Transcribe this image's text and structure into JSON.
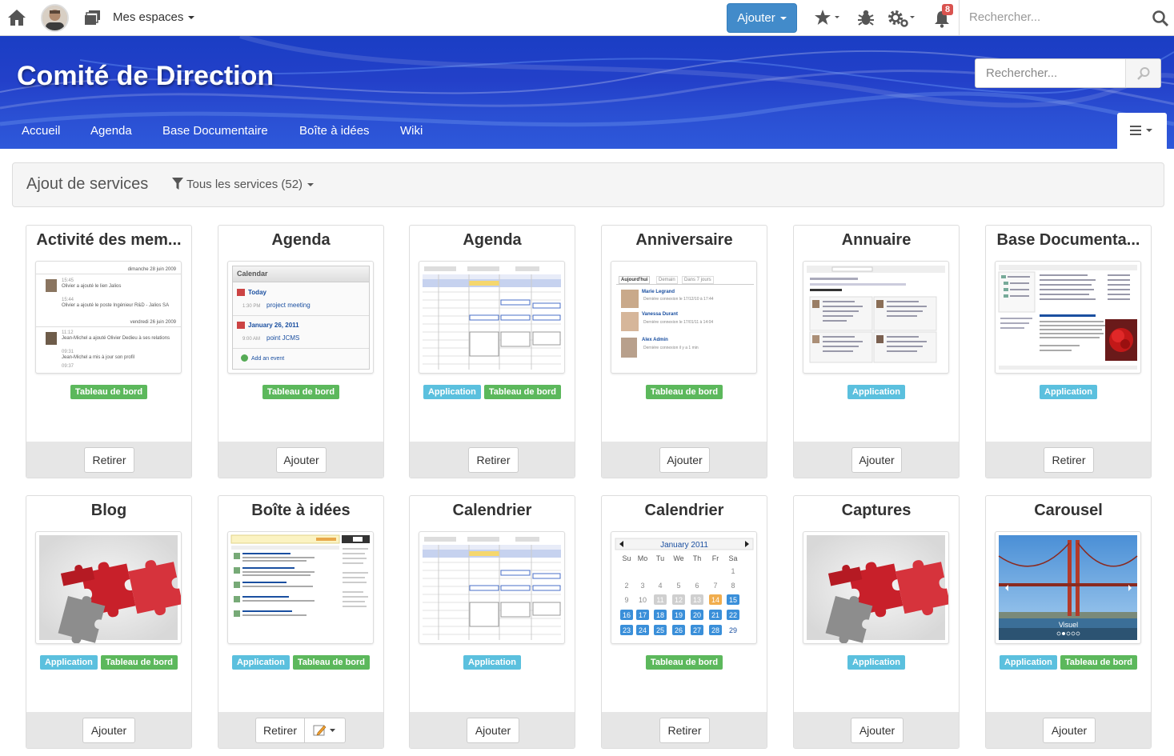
{
  "topbar": {
    "spaces_label": "Mes espaces",
    "add_label": "Ajouter",
    "notification_count": "8",
    "search_placeholder": "Rechercher..."
  },
  "banner": {
    "title": "Comité de Direction",
    "search_placeholder": "Rechercher..."
  },
  "nav": {
    "items": [
      "Accueil",
      "Agenda",
      "Base Documentaire",
      "Boîte à idées",
      "Wiki"
    ]
  },
  "services": {
    "title": "Ajout de services",
    "filter_label": "Tous les services (52)"
  },
  "labels": {
    "application": "Application",
    "dashboard": "Tableau de bord"
  },
  "cards": [
    {
      "title": "Activité des mem...",
      "action": "Retirer",
      "thumb": {
        "date1": "dimanche 28 juin 2009",
        "t1": "15:45",
        "e1": "Olivier a ajouté le lien Jalios",
        "t2": "15:44",
        "e2": "Olivier a ajouté le poste Ingénieur R&D - Jalios SA",
        "date2": "vendredi 26 juin 2009",
        "t3": "11:12",
        "e3": "Jean-Michel a ajouté Olivier Dedieu à ses relations",
        "t4": "09:31",
        "e4": "Jean-Michel a mis à jour son profil",
        "t5": "09:37"
      }
    },
    {
      "title": "Agenda",
      "action": "Ajouter",
      "thumb": {
        "header": "Calendar",
        "today": "Today",
        "time1": "1:30 PM",
        "event1": "project meeting",
        "date": "January 26, 2011",
        "time2": "9:00 AM",
        "event2": "point JCMS",
        "add": "Add an event"
      }
    },
    {
      "title": "Agenda",
      "action": "Retirer"
    },
    {
      "title": "Anniversaire",
      "action": "Ajouter",
      "thumb": {
        "tab1": "Aujourd'hui",
        "tab2": "Demain",
        "tab3": "Dans 7 jours",
        "p1": "Marie Legrand",
        "d1": "Dernière connexion le 17/12/10 à 17:44",
        "p2": "Vanessa Durant",
        "d2": "Dernière connexion le 17/01/11 à 14:04",
        "p3": "Alex Admin",
        "d3": "Dernière connexion il y a 1 min"
      }
    },
    {
      "title": "Annuaire",
      "action": "Ajouter"
    },
    {
      "title": "Base Documenta...",
      "action": "Retirer"
    },
    {
      "title": "Blog",
      "action": "Ajouter"
    },
    {
      "title": "Boîte à idées",
      "action": "Retirer"
    },
    {
      "title": "Calendrier",
      "action": "Ajouter"
    },
    {
      "title": "Calendrier",
      "action": "Retirer",
      "thumb": {
        "month": "January 2011",
        "days": [
          "Su",
          "Mo",
          "Tu",
          "We",
          "Th",
          "Fr",
          "Sa"
        ],
        "nums": [
          "1",
          "2",
          "3",
          "4",
          "5",
          "6",
          "7",
          "8",
          "9",
          "10",
          "11",
          "12",
          "13",
          "14",
          "15",
          "16",
          "17",
          "18",
          "19",
          "20",
          "21",
          "22",
          "23",
          "24",
          "25",
          "26",
          "27",
          "28",
          "29"
        ]
      }
    },
    {
      "title": "Captures",
      "action": "Ajouter"
    },
    {
      "title": "Carousel",
      "action": "Ajouter",
      "thumb": {
        "caption": "Visuel"
      }
    }
  ],
  "colors": {
    "primary": "#428bca",
    "banner": "#2340c9",
    "label_app": "#5bc0de",
    "label_dashboard": "#5cb85c",
    "badge": "#d9534f"
  }
}
